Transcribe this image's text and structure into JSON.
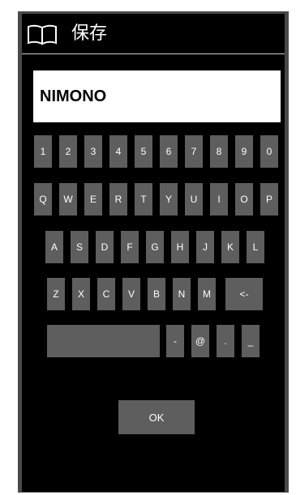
{
  "header": {
    "icon": "book-icon",
    "title": "保存"
  },
  "input": {
    "value": "NIMONO"
  },
  "keyboard": {
    "row1": [
      "1",
      "2",
      "3",
      "4",
      "5",
      "6",
      "7",
      "8",
      "9",
      "0"
    ],
    "row2": [
      "Q",
      "W",
      "E",
      "R",
      "T",
      "Y",
      "U",
      "I",
      "O",
      "P"
    ],
    "row3": [
      "A",
      "S",
      "D",
      "F",
      "G",
      "H",
      "J",
      "K",
      "L"
    ],
    "row4": [
      "Z",
      "X",
      "C",
      "V",
      "B",
      "N",
      "M"
    ],
    "backspace": "<-",
    "space": "",
    "symbols": [
      "-",
      "@",
      ".",
      "_"
    ]
  },
  "ok_label": "OK",
  "colors": {
    "background": "#000000",
    "key": "#5e5e5e",
    "text": "#ffffff",
    "frame": "#4a4a4a"
  }
}
